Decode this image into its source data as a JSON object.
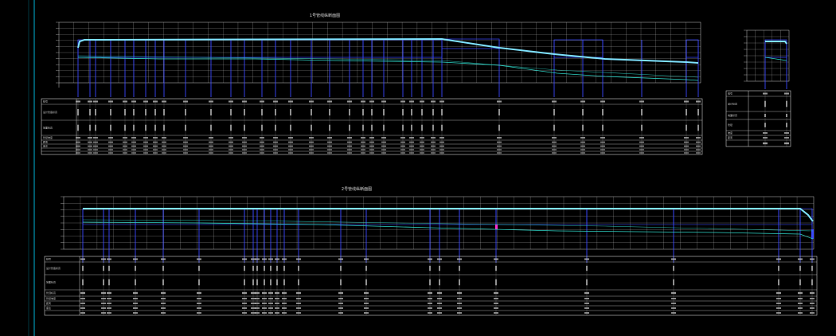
{
  "drawing": {
    "background": "#000000",
    "colors": {
      "grid": "#c8c8c8",
      "profile": "#7fe3ff",
      "ground": "#2fd6c8",
      "structure": "#3a48ff",
      "table_line": "#d0d0d0",
      "border": "#00b5d6",
      "accent": "#ff2bd0"
    },
    "panels": {
      "top_main": {
        "title": "1号管线纵断面图"
      },
      "top_small": {
        "title": ""
      },
      "bottom_main": {
        "title": "2号管线纵断面图"
      }
    },
    "table_header_labels": {
      "top_main": [
        "桩号",
        "设计管底标高",
        "地面标高",
        "管径坡度",
        "距离",
        "备注"
      ],
      "top_small": [
        "桩号",
        "设计标高",
        "地面标高",
        "管径",
        "坡度",
        "距离"
      ],
      "bottom_main": [
        "桩号",
        "设计管底标高",
        "地面标高",
        "管顶标高",
        "管径坡度",
        "距离",
        "备注"
      ]
    }
  }
}
